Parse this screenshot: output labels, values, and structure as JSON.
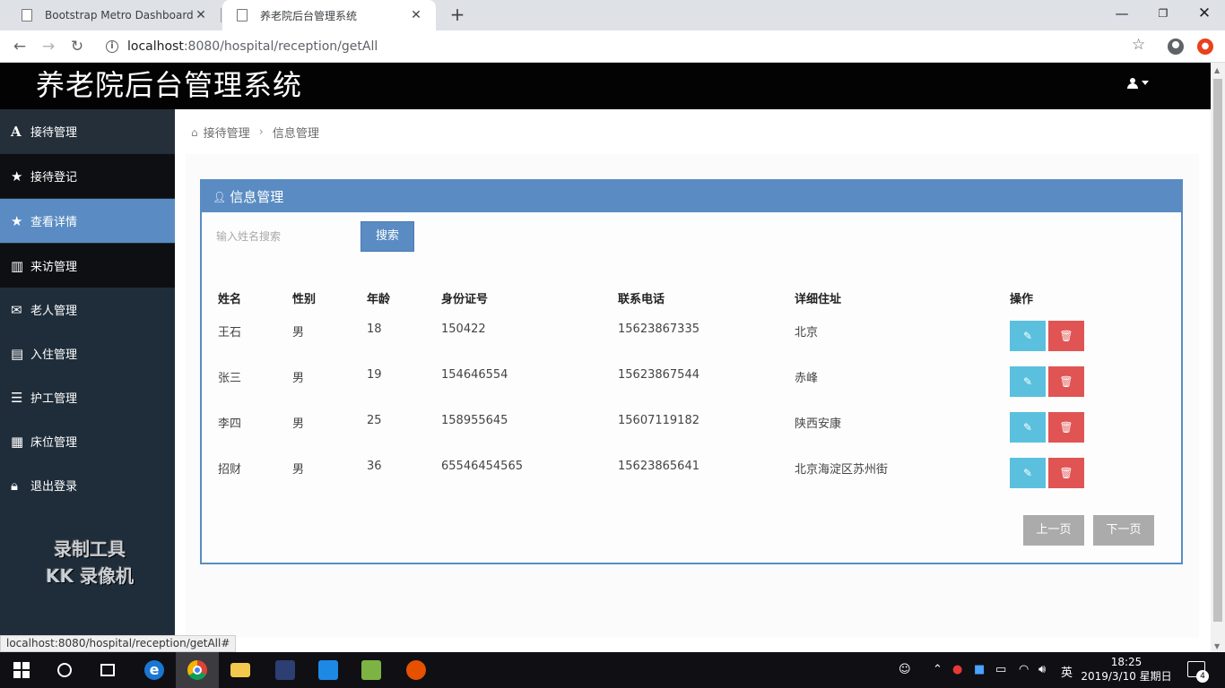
{
  "browser": {
    "tabs": [
      {
        "title": "Bootstrap Metro Dashboard b"
      },
      {
        "title": "养老院后台管理系统"
      }
    ],
    "url_host": "localhost",
    "url_path": ":8080/hospital/reception/getAll",
    "status_url": "localhost:8080/hospital/reception/getAll#"
  },
  "header": {
    "title": "养老院后台管理系统"
  },
  "sidebar": {
    "items": [
      {
        "label": "接待管理",
        "icon": "font-icon"
      },
      {
        "label": "接待登记",
        "icon": "star-icon"
      },
      {
        "label": "查看详情",
        "icon": "star-icon"
      },
      {
        "label": "来访管理",
        "icon": "bar-chart-icon"
      },
      {
        "label": "老人管理",
        "icon": "envelope-icon"
      },
      {
        "label": "入住管理",
        "icon": "hdd-icon"
      },
      {
        "label": "护工管理",
        "icon": "list-icon"
      },
      {
        "label": "床位管理",
        "icon": "calendar-icon"
      },
      {
        "label": "退出登录",
        "icon": "lock-icon"
      }
    ],
    "watermark_line1": "录制工具",
    "watermark_line2": "KK 录像机"
  },
  "breadcrumb": {
    "parent": "接待管理",
    "current": "信息管理"
  },
  "panel": {
    "title": "信息管理",
    "search_placeholder": "输入姓名搜索",
    "search_button": "搜索"
  },
  "table": {
    "headers": [
      "姓名",
      "性别",
      "年龄",
      "身份证号",
      "联系电话",
      "详细住址",
      "操作"
    ],
    "rows": [
      [
        "王石",
        "男",
        "18",
        "150422",
        "15623867335",
        "北京"
      ],
      [
        "张三",
        "男",
        "19",
        "154646554",
        "15623867544",
        "赤峰"
      ],
      [
        "李四",
        "男",
        "25",
        "158955645",
        "15607119182",
        "陕西安康"
      ],
      [
        "招财",
        "男",
        "36",
        "65546454565",
        "15623865641",
        "北京海淀区苏州街"
      ]
    ]
  },
  "pagination": {
    "prev": "上一页",
    "next": "下一页"
  },
  "taskbar": {
    "time": "18:25",
    "date": "2019/3/10 星期日",
    "ime": "英",
    "notifications": "4"
  },
  "colors": {
    "accent": "#5a8cc3",
    "sidebar_bg": "#1f2d3a",
    "header_bg": "#030303",
    "edit": "#5bc0de",
    "delete": "#e05454"
  }
}
